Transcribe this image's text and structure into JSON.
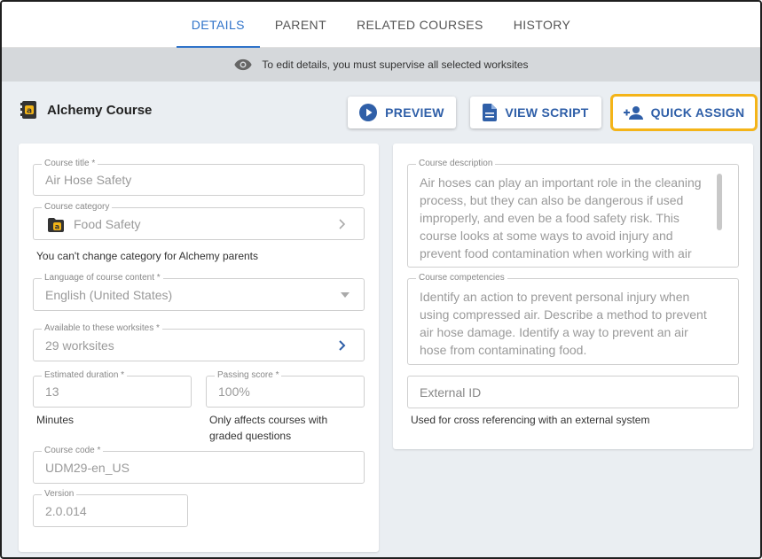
{
  "tabs": [
    {
      "label": "DETAILS",
      "active": true
    },
    {
      "label": "PARENT",
      "active": false
    },
    {
      "label": "RELATED COURSES",
      "active": false
    },
    {
      "label": "HISTORY",
      "active": false
    }
  ],
  "notice": {
    "icon": "eye-icon",
    "text": "To edit details, you must supervise all selected worksites"
  },
  "header": {
    "course_name": "Alchemy Course",
    "buttons": {
      "preview": "PREVIEW",
      "view_script": "VIEW SCRIPT",
      "quick_assign": "QUICK ASSIGN"
    },
    "accent_color": "#2f5fa8",
    "highlight_color": "#f4b418"
  },
  "form": {
    "course_title": {
      "label": "Course title *",
      "value": "Air Hose Safety"
    },
    "course_category": {
      "label": "Course category",
      "value": "Food Safety",
      "helper": "You can't change category for Alchemy parents"
    },
    "language": {
      "label": "Language of course content *",
      "value": "English (United States)"
    },
    "worksites": {
      "label": "Available to these worksites *",
      "value": "29 worksites"
    },
    "duration": {
      "label": "Estimated duration *",
      "value": "13",
      "helper": "Minutes"
    },
    "passing_score": {
      "label": "Passing score *",
      "value": "100%",
      "helper_line1": "Only affects courses with",
      "helper_line2": "graded questions"
    },
    "course_code": {
      "label": "Course code *",
      "value": "UDM29-en_US"
    },
    "version": {
      "label": "Version",
      "value": "2.0.014"
    }
  },
  "details": {
    "description": {
      "label": "Course description",
      "lines": [
        "Air hoses can play an important role in the cleaning",
        "process, but they can also be dangerous if used",
        "improperly, and even be a food safety risk.  This",
        "course looks at some ways to avoid injury and",
        "prevent food contamination when working with air"
      ]
    },
    "competencies": {
      "label": "Course competencies",
      "lines": [
        "Identify an action to prevent personal injury when",
        "using compressed air.   Describe a method to prevent",
        "air hose damage.   Identify a way to prevent an air",
        "hose from contaminating food."
      ]
    },
    "external_id": {
      "placeholder": "External ID",
      "helper": "Used for cross referencing with an external system"
    }
  }
}
